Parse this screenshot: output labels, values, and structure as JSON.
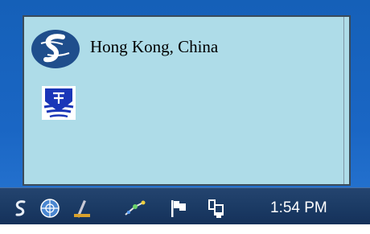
{
  "notification": {
    "title": "Hong Kong, China",
    "logo_icon": "hko-logo-icon",
    "badge_icon": "warning-shield-icon"
  },
  "taskbar": {
    "tray_icons": [
      "weather-app-icon",
      "wmo-globe-icon",
      "pen-tool-icon",
      "network-sparkle-icon",
      "action-center-flag-icon",
      "network-monitor-icon"
    ],
    "clock": "1:54 PM"
  },
  "colors": {
    "popup_background": "#aedce8",
    "taskbar": "#1c3c66",
    "desktop": "#1a66c4"
  }
}
